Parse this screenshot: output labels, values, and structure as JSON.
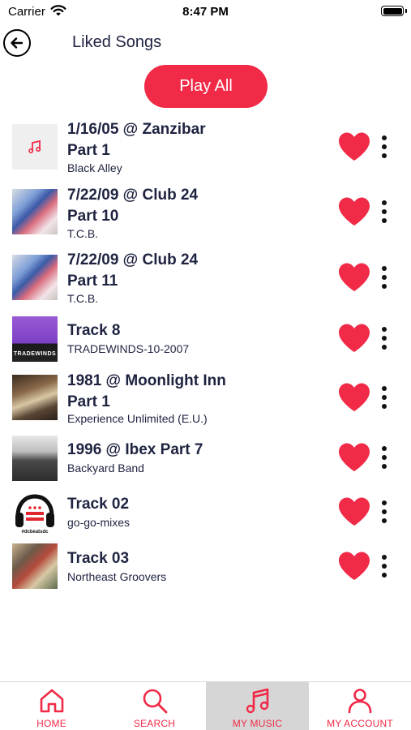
{
  "status_bar": {
    "carrier": "Carrier",
    "time": "8:47 PM"
  },
  "header": {
    "title": "Liked Songs"
  },
  "play_all_label": "Play All",
  "accent_color": "#f02a47",
  "songs": [
    {
      "title": "1/16/05 @ Zanzibar Part 1",
      "artist": "Black Alley",
      "artwork": "music-note-placeholder"
    },
    {
      "title": "7/22/09 @ Club 24 Part 10",
      "artist": "T.C.B.",
      "artwork": "band-photo"
    },
    {
      "title": "7/22/09 @ Club 24 Part 11",
      "artist": "T.C.B.",
      "artwork": "band-photo"
    },
    {
      "title": "Track 8",
      "artist": "TRADEWINDS-10-2007",
      "artwork": "tradewinds-cover",
      "artwork_text": "TRADEWINDS"
    },
    {
      "title": "1981 @ Moonlight Inn Part 1",
      "artist": "Experience Unlimited (E.U.)",
      "artwork": "stage-photo"
    },
    {
      "title": "1996 @ Ibex Part 7",
      "artist": "Backyard Band",
      "artwork": "group-photo-bw"
    },
    {
      "title": "Track 02",
      "artist": "go-go-mixes",
      "artwork": "headphones-dc-logo",
      "artwork_text": "#dcbeatsdc"
    },
    {
      "title": "Track 03",
      "artist": "Northeast Groovers",
      "artwork": "band-collage"
    }
  ],
  "tabs": [
    {
      "label": "HOME",
      "icon": "home-icon"
    },
    {
      "label": "SEARCH",
      "icon": "search-icon"
    },
    {
      "label": "MY MUSIC",
      "icon": "music-icon",
      "active": true
    },
    {
      "label": "MY ACCOUNT",
      "icon": "user-icon"
    }
  ]
}
